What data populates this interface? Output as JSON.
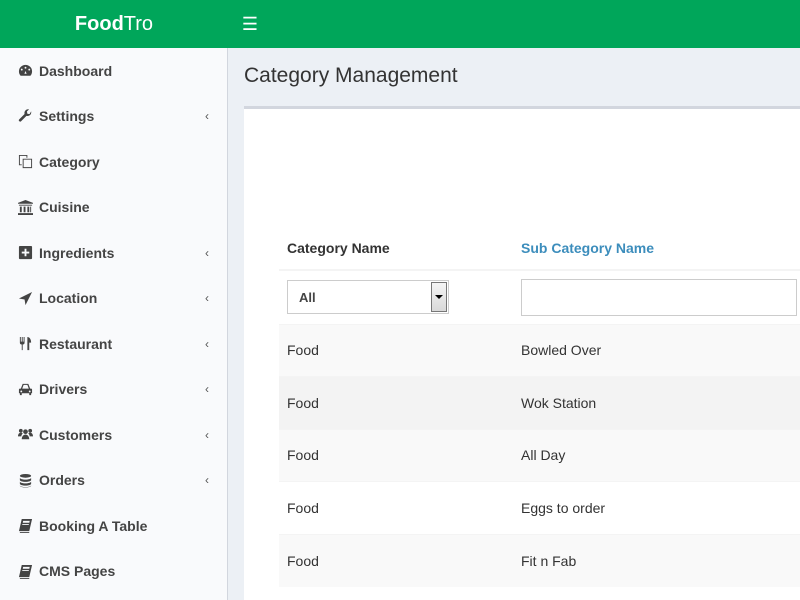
{
  "brand": {
    "bold": "Food",
    "rest": "Tro"
  },
  "topbar": {
    "menu_icon": "hamburger-icon"
  },
  "sidebar": {
    "items": [
      {
        "label": "Dashboard",
        "icon": "dashboard-icon",
        "has_submenu": false
      },
      {
        "label": "Settings",
        "icon": "wrench-icon",
        "has_submenu": true
      },
      {
        "label": "Category",
        "icon": "copy-icon",
        "has_submenu": false
      },
      {
        "label": "Cuisine",
        "icon": "bank-icon",
        "has_submenu": false
      },
      {
        "label": "Ingredients",
        "icon": "plus-square-icon",
        "has_submenu": true
      },
      {
        "label": "Location",
        "icon": "location-arrow-icon",
        "has_submenu": true
      },
      {
        "label": "Restaurant",
        "icon": "cutlery-icon",
        "has_submenu": true
      },
      {
        "label": "Drivers",
        "icon": "taxi-icon",
        "has_submenu": true
      },
      {
        "label": "Customers",
        "icon": "users-icon",
        "has_submenu": true
      },
      {
        "label": "Orders",
        "icon": "database-icon",
        "has_submenu": true
      },
      {
        "label": "Booking A Table",
        "icon": "book-icon",
        "has_submenu": false
      },
      {
        "label": "CMS Pages",
        "icon": "book-icon",
        "has_submenu": false
      }
    ],
    "chevron": "‹"
  },
  "page": {
    "title": "Category Management"
  },
  "table": {
    "headers": [
      "Category Name",
      "Sub Category Name"
    ],
    "filters": {
      "category_select_value": "All",
      "subcategory_input_value": "",
      "subcategory_input_placeholder": ""
    },
    "rows": [
      [
        "Food",
        "Bowled Over"
      ],
      [
        "Food",
        "Wok Station"
      ],
      [
        "Food",
        "All Day"
      ],
      [
        "Food",
        "Eggs to order"
      ],
      [
        "Food",
        "Fit n Fab"
      ]
    ]
  },
  "colors": {
    "brand_green": "#00a65a",
    "link_blue": "#3c8dbc",
    "content_bg": "#ecf0f5",
    "sidebar_bg": "#f9fafc"
  }
}
